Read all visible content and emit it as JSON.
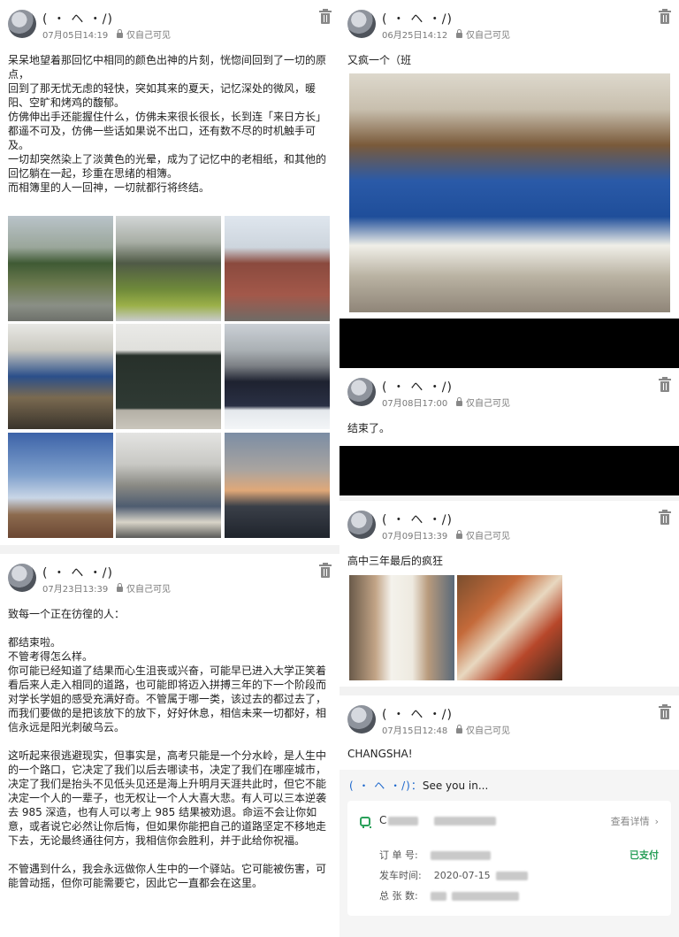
{
  "posts": [
    {
      "nickname": "( ・ ヘ ・/)",
      "date": "07月05日14:19",
      "privacy": "仅自己可见",
      "paragraphs": [
        "呆呆地望着那回忆中相同的颜色出神的片刻，恍惚间回到了一切的原点，",
        "回到了那无忧无虑的轻快，突如其来的夏天，记忆深处的微风，暖阳、空旷和烤鸡的馥郁。",
        "仿佛伸出手还能握住什么，仿佛未来很长很长，长到连「来日方长」都遥不可及，仿佛一些话如果说不出口，还有数不尽的时机触手可及。",
        "一切却突然染上了淡黄色的光晕，成为了记忆中的老相纸，和其他的回忆躺在一起，珍重在思绪的相簿。",
        "而相簿里的人一回神，一切就都行将终结。"
      ],
      "photos": [
        "campus-trees",
        "pond-with-monument",
        "running-track",
        "classroom-desks",
        "blackboard-flag",
        "group-photo-snow",
        "sunset-stadium",
        "classroom-papers",
        "dusk-buildings"
      ]
    },
    {
      "nickname": "( ・ ヘ ・/)",
      "date": "07月23日13:39",
      "privacy": "仅自己可见",
      "paragraphs": [
        "致每一个正在彷徨的人：",
        "",
        "都结束啦。",
        "不管考得怎么样。",
        "你可能已经知道了结果而心生沮丧或兴奋，可能早已进入大学正笑着看后来人走入相同的道路，也可能即将迈入拼搏三年的下一个阶段而对学长学姐的感受充满好奇。不管属于哪一类，该过去的都过去了，而我们要做的是把该放下的放下，好好休息，相信未来一切都好，相信永远是阳光刺破乌云。",
        "",
        "这听起来很逃避现实，但事实是，高考只能是一个分水岭，是人生中的一个路口，它决定了我们以后去哪读书，决定了我们在哪座城市，决定了我们是抬头不见低头见还是海上升明月天涯共此时，但它不能决定一个人的一辈子，也无权让一个人大喜大悲。有人可以三本逆袭去 985 深造，也有人可以考上 985 结果被劝退。命运不会让你如意，或者说它必然让你后悔，但如果你能把自己的道路坚定不移地走下去，无论最终通往何方，我相信你会胜利，并于此给你祝福。",
        "",
        "不管遇到什么，我会永远做你人生中的一个驿站。它可能被伤害，可能曾动摇，但你可能需要它，因此它一直都会在这里。"
      ]
    },
    {
      "nickname": "( ・ ヘ ・/)",
      "date": "06月25日14:12",
      "privacy": "仅自己可见",
      "text": "又疯一个（班",
      "photo": "classroom-students-back-view"
    },
    {
      "nickname": "( ・ ヘ ・/)",
      "date": "07月08日17:00",
      "privacy": "仅自己可见",
      "text": "结束了。"
    },
    {
      "nickname": "( ・ ヘ ・/)",
      "date": "07月09日13:39",
      "privacy": "仅自己可见",
      "text": "高中三年最后的疯狂",
      "photos": [
        "receipt-in-hand",
        "hotpot-table"
      ]
    },
    {
      "nickname": "( ・ ヘ ・/)",
      "date": "07月15日12:48",
      "privacy": "仅自己可见",
      "text": "CHANGSHA!",
      "comment_author": "( ・ ヘ ・/)：",
      "comment_text": "See you in...",
      "order": {
        "title_start": "C",
        "details_link": "查看详情",
        "status": "已支付",
        "order_no_label": "订 单 号:",
        "depart_label": "发车时间:",
        "depart_value": "2020-07-15",
        "count_label": "总 张 数:"
      }
    }
  ],
  "colors": {
    "paid_green": "#2aa05a",
    "muted": "#777777",
    "accent_link": "#1a66cc"
  }
}
